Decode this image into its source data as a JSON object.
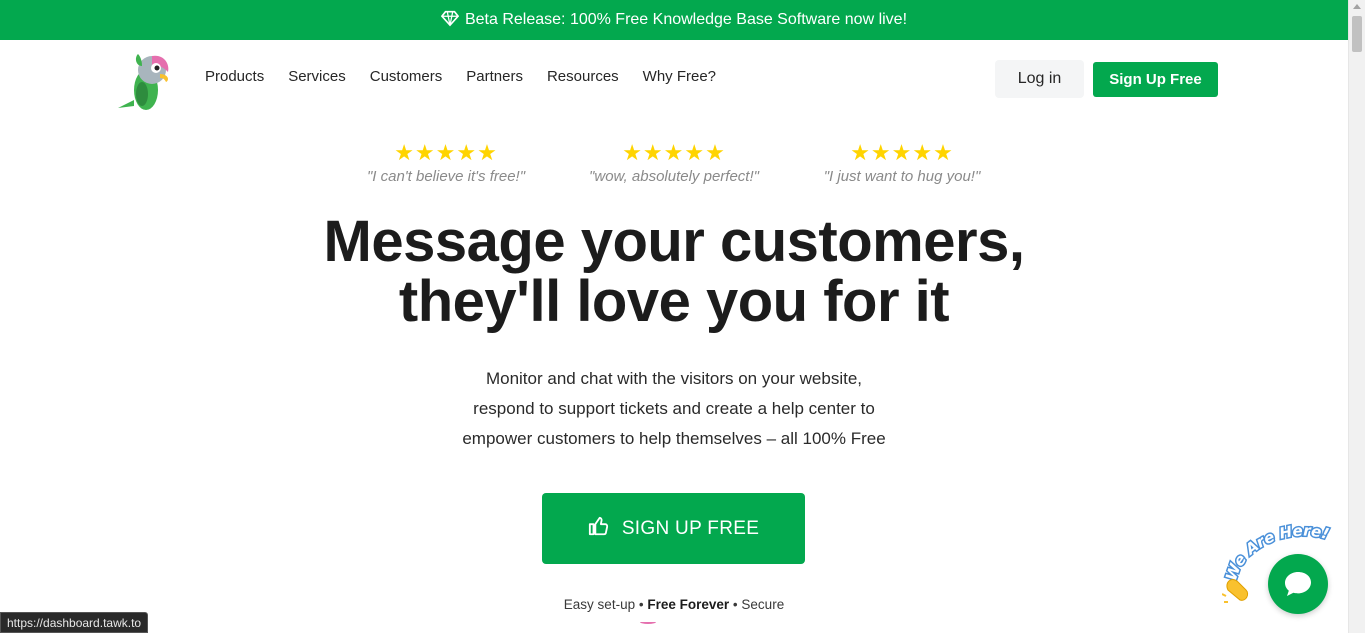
{
  "banner": {
    "icon": "diamond-icon",
    "text": "Beta Release: 100% Free Knowledge Base Software now live!"
  },
  "nav": {
    "logo": "parrot-logo",
    "items": [
      "Products",
      "Services",
      "Customers",
      "Partners",
      "Resources",
      "Why Free?"
    ],
    "login_label": "Log in",
    "signup_label": "Sign Up Free"
  },
  "reviews": [
    {
      "stars": "★★★★★",
      "quote": "\"I can't believe it's free!\""
    },
    {
      "stars": "★★★★★",
      "quote": "\"wow, absolutely perfect!\""
    },
    {
      "stars": "★★★★★",
      "quote": "\"I just want to hug you!\""
    }
  ],
  "hero": {
    "headline_line1": "Message your customers,",
    "headline_line2": "they'll love you for it",
    "sub_line1": "Monitor and chat with the visitors on your website,",
    "sub_line2": "respond to support tickets and create a help center to",
    "sub_line3": "empower customers to help themselves – all 100% Free",
    "cta_label": "SIGN UP FREE",
    "cta_icon": "thumbs-up-icon"
  },
  "tagline": {
    "part1": "Easy set-up",
    "sep": "•",
    "part2": "Free Forever",
    "part3": "Secure"
  },
  "status_url": "https://dashboard.tawk.to",
  "chat_widget": {
    "text": "We Are Here!",
    "icon": "chat-bubble-icon",
    "color": "#03a84e"
  },
  "colors": {
    "brand_green": "#03a84e",
    "star": "#ffd400"
  }
}
